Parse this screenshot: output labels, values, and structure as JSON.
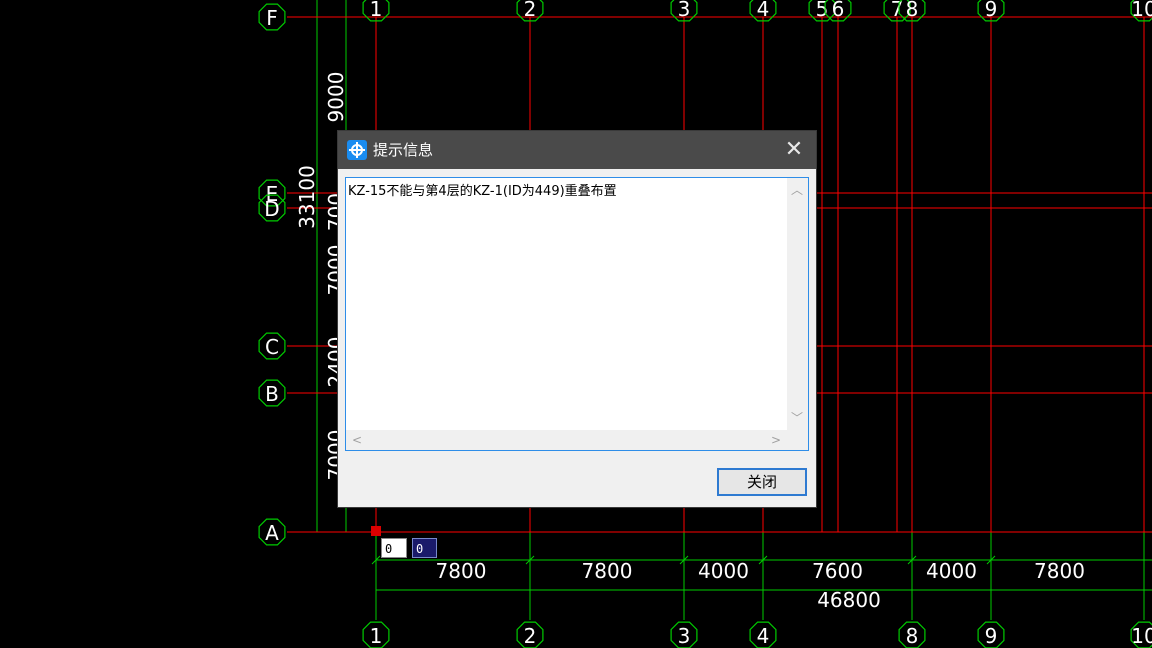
{
  "cad": {
    "colors": {
      "grid": "#ff0000",
      "dim": "#00cc00",
      "label": "#ffffff"
    },
    "top_axes": [
      "1",
      "2",
      "3",
      "4",
      "5",
      "6",
      "7",
      "8",
      "9",
      "10"
    ],
    "bottom_axes": [
      "1",
      "2",
      "3",
      "4",
      "8",
      "9",
      "10"
    ],
    "left_axes": [
      "F",
      "E",
      "D",
      "C",
      "B",
      "A"
    ],
    "bottom_dims": [
      "7800",
      "7800",
      "4000",
      "7600",
      "4000",
      "7800"
    ],
    "bottom_total": "46800",
    "left_dims": [
      "9000",
      "700",
      "7000",
      "2400",
      "7000"
    ],
    "left_total": "33100"
  },
  "coord_input": {
    "x": "0",
    "y": "0"
  },
  "dialog": {
    "title": "提示信息",
    "message": "KZ-15不能与第4层的KZ-1(ID为449)重叠布置",
    "close_label": "关闭",
    "close_icon": "✕"
  }
}
